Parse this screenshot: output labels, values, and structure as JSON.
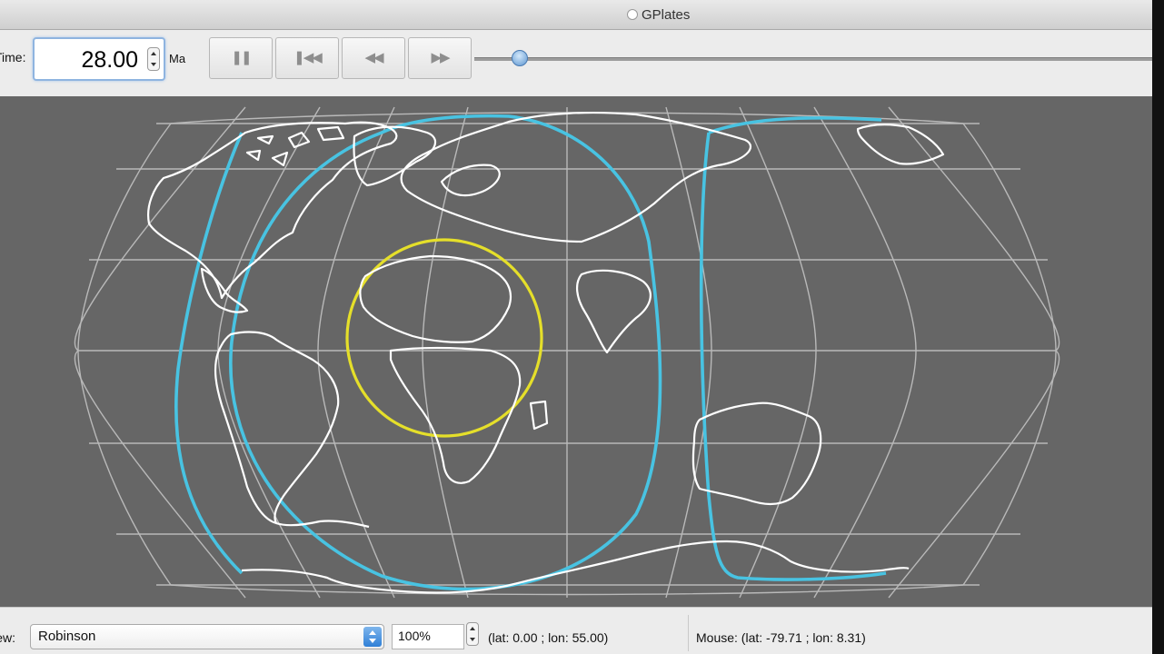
{
  "window": {
    "title": "GPlates"
  },
  "toolbar": {
    "time_label": "Time:",
    "time_value": "28.00",
    "time_units": "Ma",
    "play_icon": "play-pause-icon",
    "reset_icon": "reset-to-start-icon",
    "rewind_icon": "step-backward-icon",
    "forward_icon": "step-forward-icon",
    "slider_value_fraction": 0.07
  },
  "map": {
    "projection": "Robinson",
    "colors": {
      "background": "#666666",
      "graticule": "#b9b9b9",
      "coastlines": "#ffffff",
      "selection_lines": "#48c3e2",
      "highlight_circle": "#e5df2a"
    }
  },
  "statusbar": {
    "view_label": "View:",
    "projection": "Robinson",
    "zoom": "100%",
    "camera": "(lat: 0.00 ; lon: 55.00)",
    "mouse": "Mouse: (lat: -79.71 ; lon: 8.31)"
  }
}
